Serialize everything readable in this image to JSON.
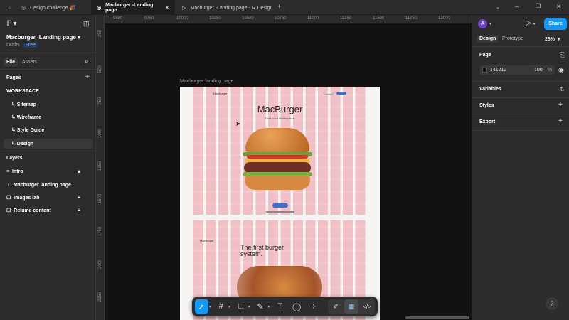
{
  "tabs": [
    {
      "label": "Design challenge 🎉"
    },
    {
      "label": "Macburger -Landing page"
    },
    {
      "label": "Macburger -Landing page - ↳ Design"
    }
  ],
  "ruler_top": [
    "9500",
    "9750",
    "10000",
    "10250",
    "10500",
    "10750",
    "11000",
    "11250",
    "11500",
    "11750",
    "12000"
  ],
  "ruler_left": [
    "250",
    "500",
    "750",
    "1000",
    "1250",
    "1500",
    "1750",
    "2000",
    "2250"
  ],
  "left": {
    "file_name": "Macburger -Landing page",
    "drafts": "Drafts",
    "plan_badge": "Free",
    "tab_file": "File",
    "tab_assets": "Assets",
    "pages_header": "Pages",
    "pages": [
      {
        "label": "WORKSPACE"
      },
      {
        "label": "↳ Sitemap"
      },
      {
        "label": "↳ Wireframe"
      },
      {
        "label": "↳ Style Guide"
      },
      {
        "label": "↳ Design"
      }
    ],
    "layers_header": "Layers",
    "layers": [
      {
        "label": "Intro"
      },
      {
        "label": "Macburger landing page"
      },
      {
        "label": "Images lab"
      },
      {
        "label": "Relume content"
      }
    ]
  },
  "canvas": {
    "frame_label": "Macburger landing page",
    "site_logo": "MacBurger",
    "hero_title": "MacBurger",
    "hero_subtitle": "Fast Food Masterpiece",
    "section_label": "MacBurger",
    "section_title": "The first burger system."
  },
  "right": {
    "avatar": "A",
    "share": "Share",
    "tab_design": "Design",
    "tab_prototype": "Prototype",
    "zoom": "26%",
    "page_header": "Page",
    "page_color": "141212",
    "page_opacity": "100",
    "percent": "%",
    "variables": "Variables",
    "styles": "Styles",
    "export": "Export"
  },
  "help": "?"
}
